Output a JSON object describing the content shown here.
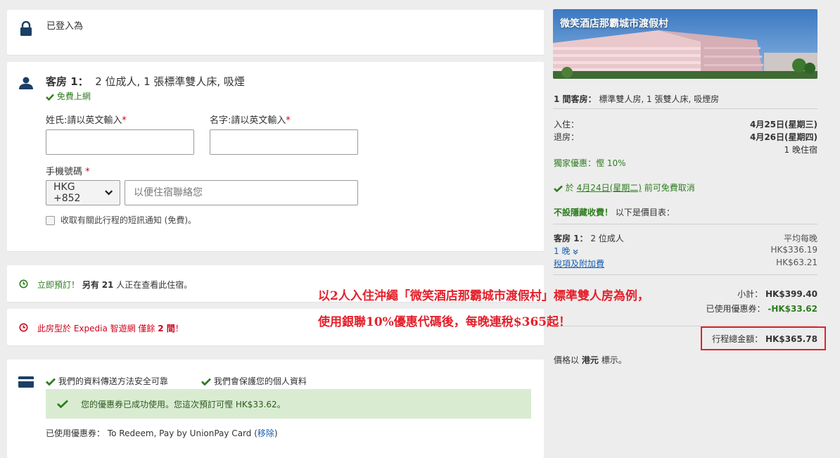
{
  "login": {
    "text": "已登入為"
  },
  "room": {
    "title_label": "客房 1：",
    "title_desc": "2 位成人, 1 張標準雙人床, 吸煙",
    "wifi": "免費上網",
    "surname_label": "姓氏:請以英文輸入",
    "given_label": "名字:請以英文輸入",
    "required_mark": "*",
    "phone_label": "手機號碼",
    "country_code": "HKG +852",
    "phone_placeholder": "以便住宿聯絡您",
    "sms_label": "收取有關此行程的短訊通知 (免費)。"
  },
  "book_now": {
    "prefix": "立即預訂！",
    "text_a": "另有",
    "count": "21",
    "text_b": "人正在查看此住宿。"
  },
  "scarcity": {
    "prefix": "此房型於 Expedia 智遊網 僅餘",
    "count": "2 間",
    "suffix": "！"
  },
  "payment": {
    "secure1": "我們的資料傳送方法安全可靠",
    "secure2": "我們會保護您的個人資料",
    "coupon_success": "您的優惠券已成功使用。您這次預訂可慳 HK$33.62。",
    "coupon_used_label": "已使用優惠券：",
    "coupon_name": "To Redeem, Pay by UnionPay Card",
    "remove_open": "(",
    "remove_link": "移除",
    "remove_close": ")"
  },
  "hotel": {
    "name": "微笑酒店那霸城市渡假村",
    "rooms_label": "1 間客房：",
    "rooms_desc": "標準雙人房, 1 張雙人床, 吸煙房",
    "checkin_label": "入住：",
    "checkin_date": "4月25日(星期三)",
    "checkout_label": "退房：",
    "checkout_date": "4月26日(星期四)",
    "nights": "1 晚住宿",
    "deal": "獨家優惠：慳 10%",
    "cancel_prefix": "於",
    "cancel_date": "4月24日(星期二)",
    "cancel_suffix": "前可免費取消",
    "no_hidden_fee": "不設隱藏收費！",
    "price_list": "以下是價目表：",
    "room1_label": "客房 1：",
    "room1_desc": "2 位成人",
    "avg_label": "平均每晚",
    "night_link": "1 晚",
    "night_price": "HK$336.19",
    "tax_link": "稅項及附加費",
    "tax_price": "HK$63.21",
    "subtotal_label": "小計：",
    "subtotal": "HK$399.40",
    "coupon_label": "已使用優惠券：",
    "coupon_amount": "-HK$33.62",
    "total_label": "行程總金額：",
    "total": "HK$365.78",
    "currency_a": "價格以",
    "currency_b": "港元",
    "currency_c": "標示。"
  },
  "annotation": {
    "line1": "以2人入住沖繩「微笑酒店那霸城市渡假村」標準雙人房為例，",
    "line2": "使用銀聯10%優惠代碼後，每晚連稅$365起！"
  },
  "colors": {
    "green": "#2e7d1f",
    "red": "#d0021b",
    "link": "#1a5fb4",
    "icon": "#1c3f66",
    "highlight": "#e4202b"
  }
}
